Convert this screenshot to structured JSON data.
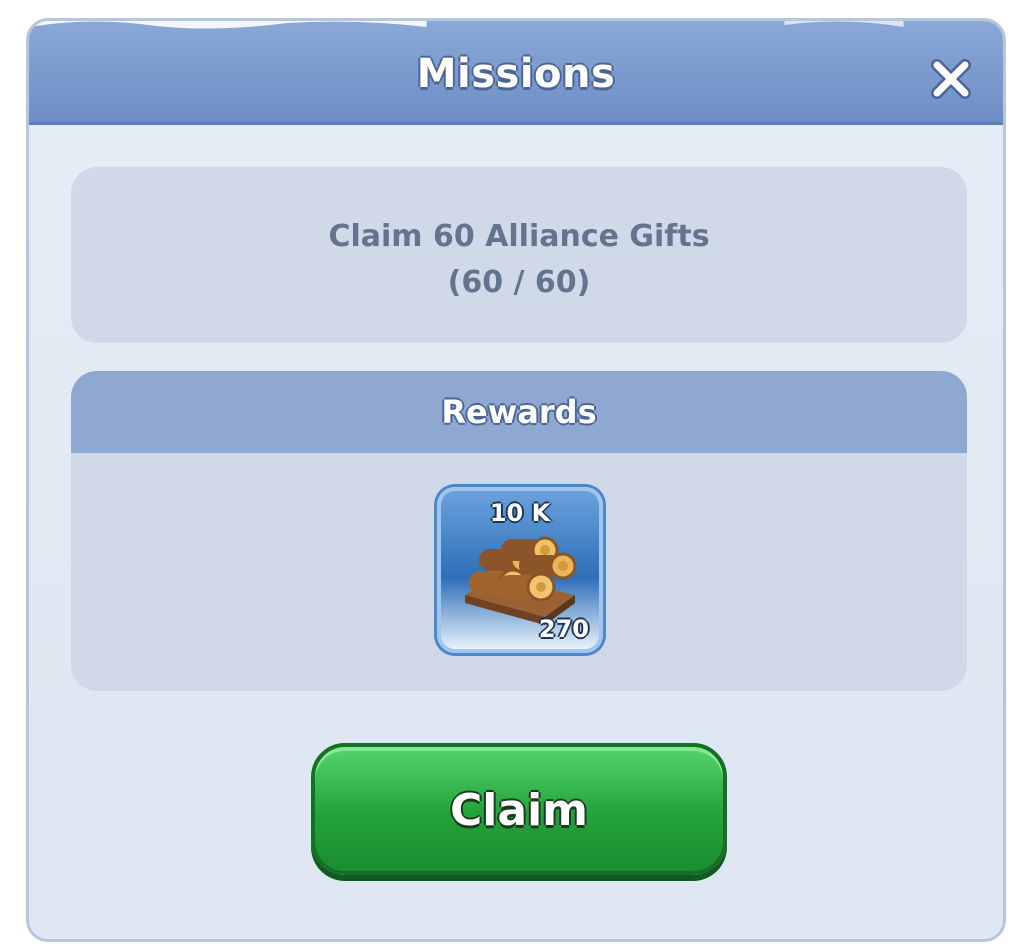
{
  "window": {
    "title": "Missions"
  },
  "mission": {
    "text": "Claim 60 Alliance Gifts",
    "progress": "(60 / 60)"
  },
  "rewards": {
    "title": "Rewards",
    "items": [
      {
        "icon": "wood-logs-icon",
        "amount": "10 K",
        "count": "270"
      }
    ]
  },
  "actions": {
    "claim_label": "Claim"
  },
  "colors": {
    "titlebar": "#7b9bd0",
    "panel": "#e3eaf4",
    "box": "#cfd9e8",
    "claim": "#23a23a"
  }
}
